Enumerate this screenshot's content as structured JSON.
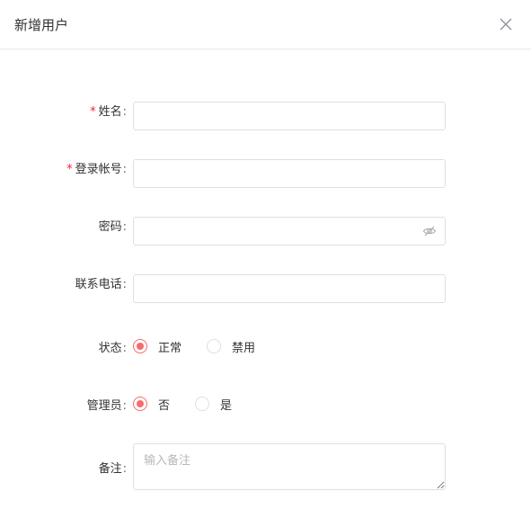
{
  "dialog": {
    "title": "新增用户",
    "close_icon": "close-icon"
  },
  "form": {
    "name": {
      "label": "姓名",
      "required": true,
      "value": ""
    },
    "account": {
      "label": "登录帐号",
      "required": true,
      "value": ""
    },
    "password": {
      "label": "密码",
      "required": false,
      "value": "",
      "toggle_icon": "eye-off-icon"
    },
    "phone": {
      "label": "联系电话",
      "required": false,
      "value": ""
    },
    "status": {
      "label": "状态",
      "options": [
        "正常",
        "禁用"
      ],
      "selected": "正常"
    },
    "admin": {
      "label": "管理员",
      "options": [
        "否",
        "是"
      ],
      "selected": "否"
    },
    "remark": {
      "label": "备注",
      "placeholder": "输入备注",
      "value": ""
    }
  },
  "colors": {
    "accent": "#f56c6c",
    "required_star": "#f5222d",
    "border": "#dcdfe6"
  }
}
